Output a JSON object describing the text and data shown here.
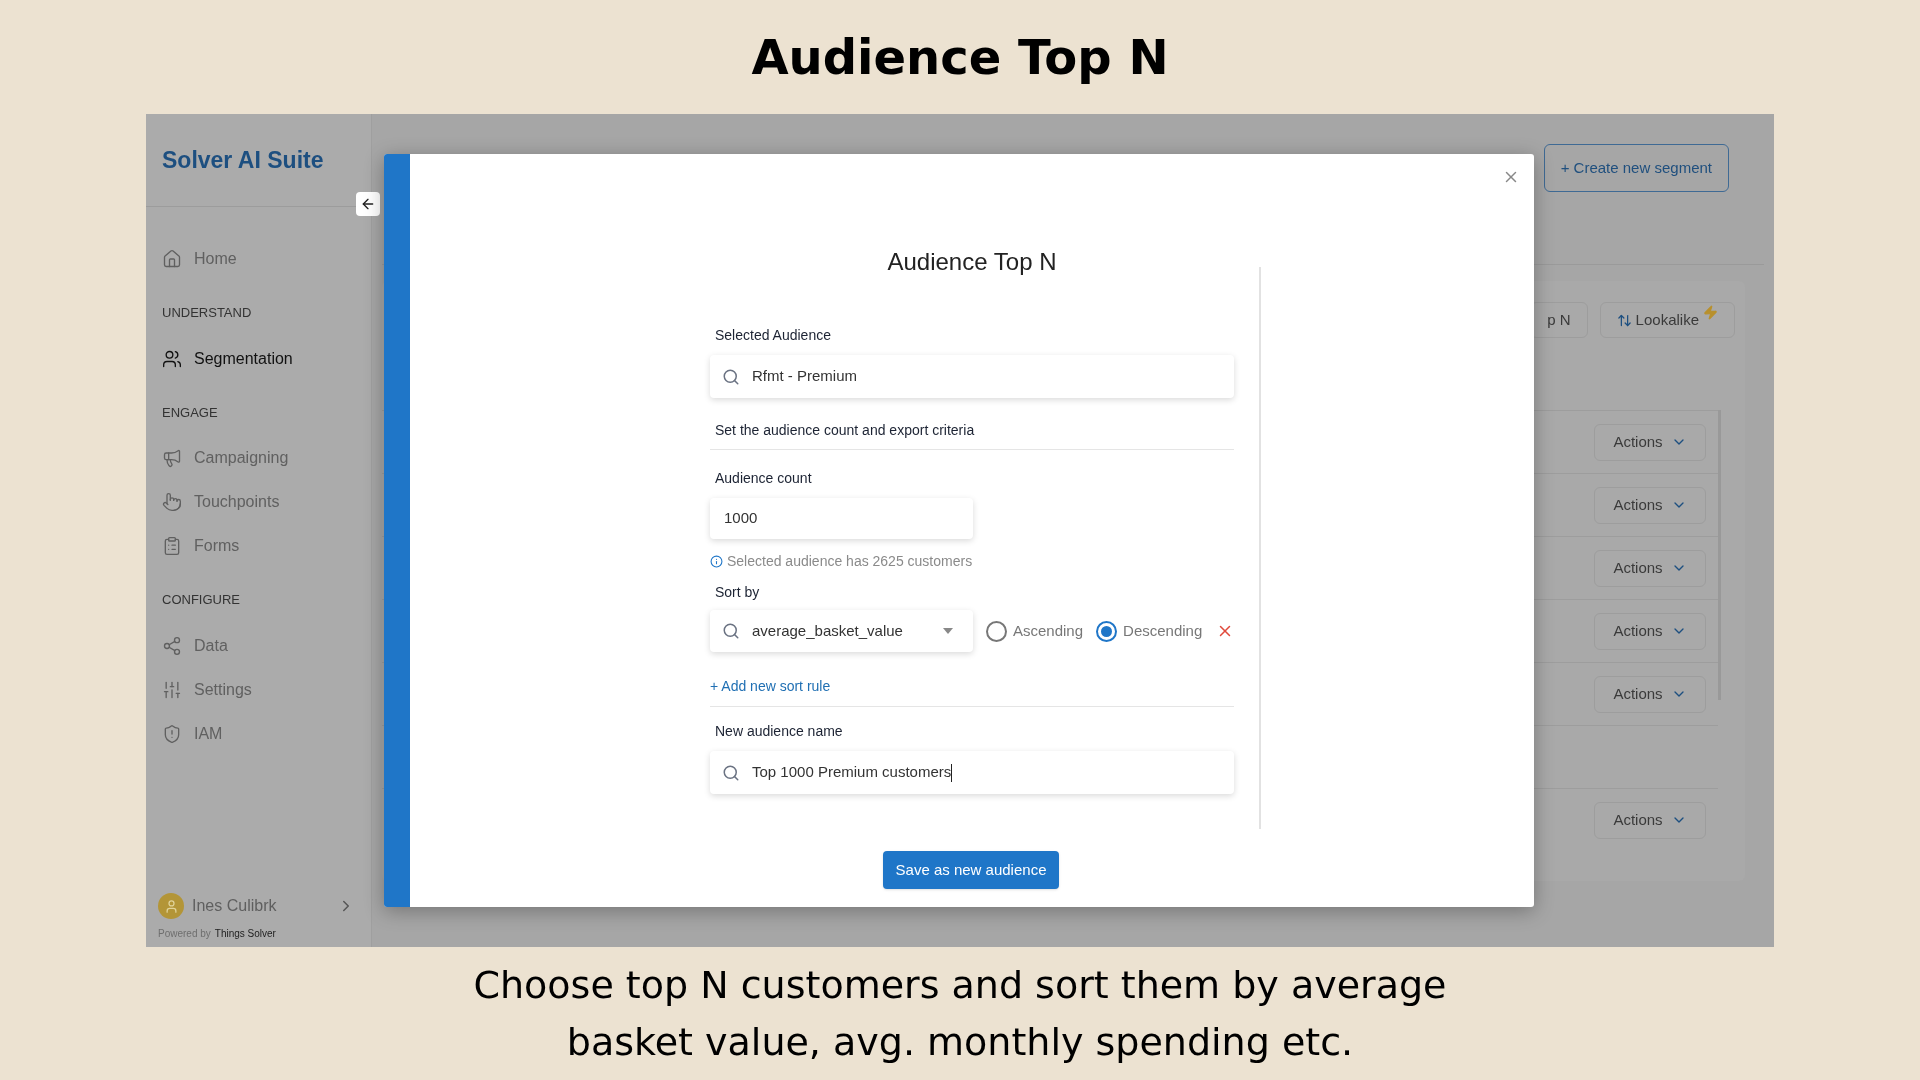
{
  "slide": {
    "title": "Audience Top N",
    "caption": "Choose top N customers and sort them by average basket value, avg. monthly spending etc."
  },
  "app": {
    "brand": "Solver AI Suite",
    "nav": [
      {
        "kind": "item",
        "label": "Home",
        "selected": false
      },
      {
        "kind": "section",
        "label": "UNDERSTAND"
      },
      {
        "kind": "item",
        "label": "Segmentation",
        "selected": true
      },
      {
        "kind": "section",
        "label": "ENGAGE"
      },
      {
        "kind": "item",
        "label": "Campaigning",
        "selected": false
      },
      {
        "kind": "item",
        "label": "Touchpoints",
        "selected": false
      },
      {
        "kind": "item",
        "label": "Forms",
        "selected": false
      },
      {
        "kind": "section",
        "label": "CONFIGURE"
      },
      {
        "kind": "item",
        "label": "Data",
        "selected": false
      },
      {
        "kind": "item",
        "label": "Settings",
        "selected": false
      },
      {
        "kind": "item",
        "label": "IAM",
        "selected": false
      }
    ],
    "user": {
      "name": "Ines Culibrk"
    },
    "powered_by": "Powered by",
    "powered_company": "Things Solver",
    "create_button": "+ Create new segment",
    "toolbar_buttons": [
      "p N",
      "Lookalike"
    ],
    "rows": [
      {
        "kind": "action",
        "label": "Actions"
      },
      {
        "kind": "action",
        "label": "Actions"
      },
      {
        "kind": "action",
        "label": "Actions"
      },
      {
        "kind": "action",
        "label": "Actions"
      },
      {
        "kind": "action",
        "label": "Actions"
      },
      {
        "kind": "blank"
      },
      {
        "kind": "action",
        "label": "Actions"
      }
    ]
  },
  "modal": {
    "title": "Audience Top N",
    "selected_audience": {
      "label": "Selected Audience",
      "value": "Rfmt - Premium"
    },
    "section_title": "Set the audience count and export criteria",
    "audience_count": {
      "label": "Audience count",
      "value": "1000"
    },
    "info": "Selected audience has 2625 customers",
    "sort_label": "Sort by",
    "sort_rules": [
      {
        "field": "average_basket_value",
        "directions": [
          {
            "label": "Ascending",
            "selected": false
          },
          {
            "label": "Descending",
            "selected": true
          }
        ]
      }
    ],
    "add_rule": "+ Add new sort rule",
    "new_name": {
      "label": "New audience name",
      "value": "Top 1000 Premium customers",
      "focused": true
    },
    "save_button": "Save as new audience"
  }
}
